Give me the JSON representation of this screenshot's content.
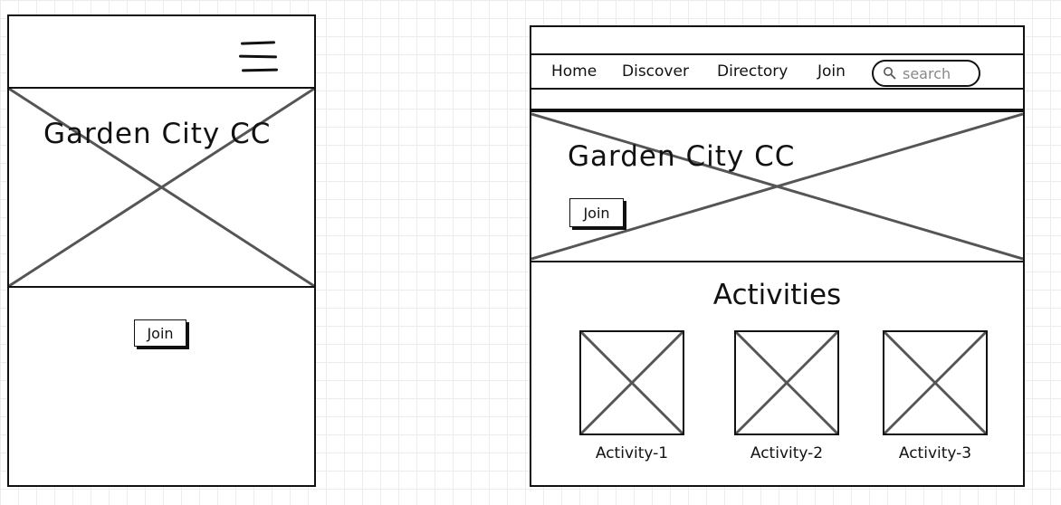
{
  "mobile": {
    "menu_icon": "hamburger-icon",
    "hero_title": "Garden City CC",
    "join_label": "Join"
  },
  "desktop": {
    "nav": {
      "items": [
        "Home",
        "Discover",
        "Directory",
        "Join"
      ],
      "search_placeholder": "search",
      "search_icon": "magnifier-icon"
    },
    "hero_title": "Garden City CC",
    "join_label": "Join",
    "activities_title": "Activities",
    "activities": [
      {
        "label": "Activity-1"
      },
      {
        "label": "Activity-2"
      },
      {
        "label": "Activity-3"
      }
    ]
  },
  "colors": {
    "ink": "#111111",
    "cross": "#555555",
    "grid": "#ececec"
  }
}
